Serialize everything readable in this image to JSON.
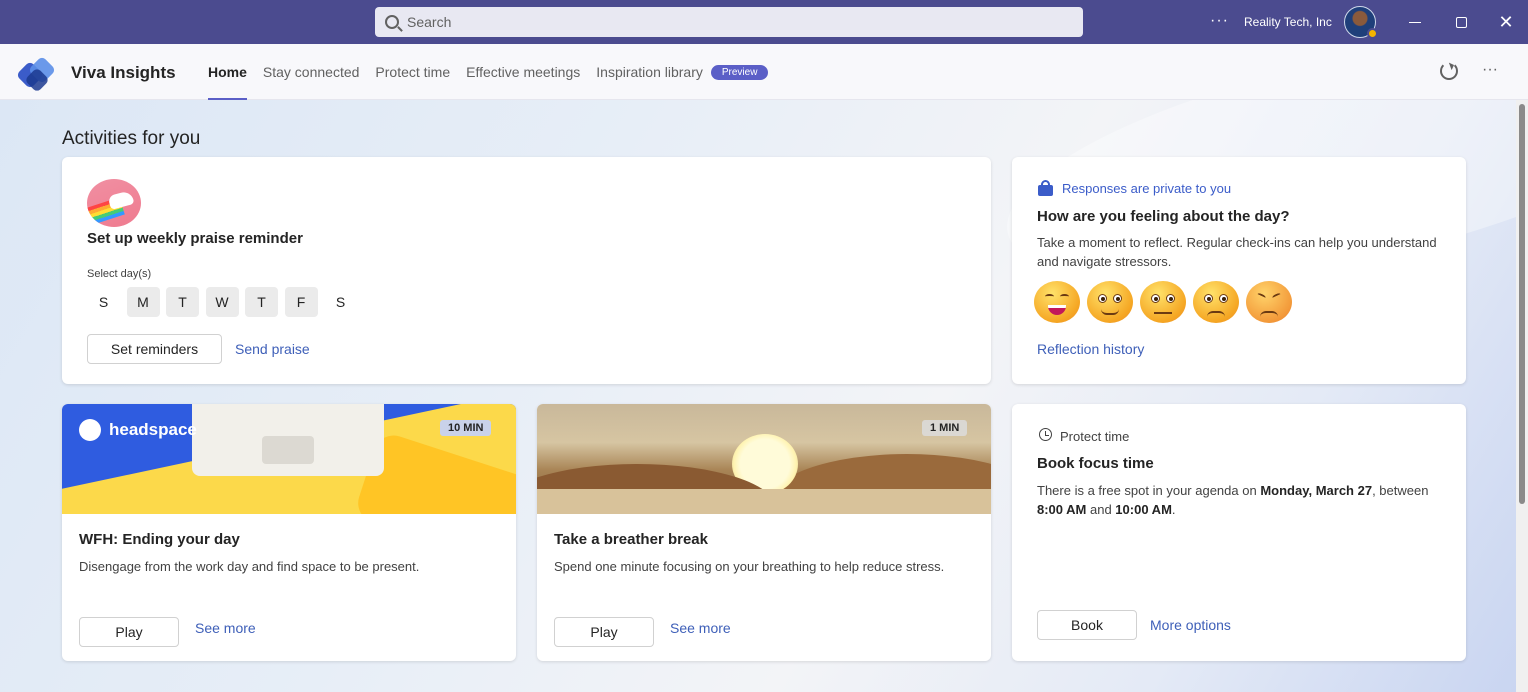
{
  "titlebar": {
    "search_placeholder": "Search",
    "org_name": "Reality Tech, Inc",
    "more": "···",
    "close": "✕"
  },
  "app": {
    "title": "Viva Insights",
    "tabs": [
      {
        "label": "Home",
        "active": true
      },
      {
        "label": "Stay connected"
      },
      {
        "label": "Protect time"
      },
      {
        "label": "Effective meetings"
      },
      {
        "label": "Inspiration library"
      }
    ],
    "preview_badge": "Preview",
    "more": "···"
  },
  "section_title": "Activities for you",
  "praise": {
    "title": "Set up weekly praise reminder",
    "select_label": "Select day(s)",
    "days": [
      {
        "label": "S",
        "selected": false
      },
      {
        "label": "M",
        "selected": true
      },
      {
        "label": "T",
        "selected": true
      },
      {
        "label": "W",
        "selected": true
      },
      {
        "label": "T",
        "selected": true
      },
      {
        "label": "F",
        "selected": true
      },
      {
        "label": "S",
        "selected": false
      }
    ],
    "set_button": "Set reminders",
    "send_link": "Send praise"
  },
  "feeling": {
    "private_note": "Responses are private to you",
    "title": "How are you feeling about the day?",
    "description": "Take a moment to reflect. Regular check-ins can help you understand and navigate stressors.",
    "emojis": [
      "very-happy-emoji",
      "happy-emoji",
      "neutral-emoji",
      "sad-emoji",
      "upset-emoji"
    ],
    "history_link": "Reflection history"
  },
  "headspace": {
    "brand": "headspace",
    "duration": "10 MIN",
    "title": "WFH: Ending your day",
    "description": "Disengage from the work day and find space to be present.",
    "play_button": "Play",
    "see_more": "See more"
  },
  "breather": {
    "duration": "1 MIN",
    "title": "Take a breather break",
    "description": "Spend one minute focusing on your breathing to help reduce stress.",
    "play_button": "Play",
    "see_more": "See more"
  },
  "focus": {
    "category": "Protect time",
    "title": "Book focus time",
    "desc_pre": "There is a free spot in your agenda on ",
    "date_day": "Monday",
    "date_comma": ", ",
    "date": "March 27",
    "desc_mid": ", between ",
    "start": "8:00 AM",
    "and": " and ",
    "end": "10:00 AM",
    "period": ".",
    "book_button": "Book",
    "more_options": "More options"
  },
  "colors": {
    "titlebar": "#4b4b8f",
    "accent": "#5b5fc7",
    "link": "#3e5fb8"
  }
}
